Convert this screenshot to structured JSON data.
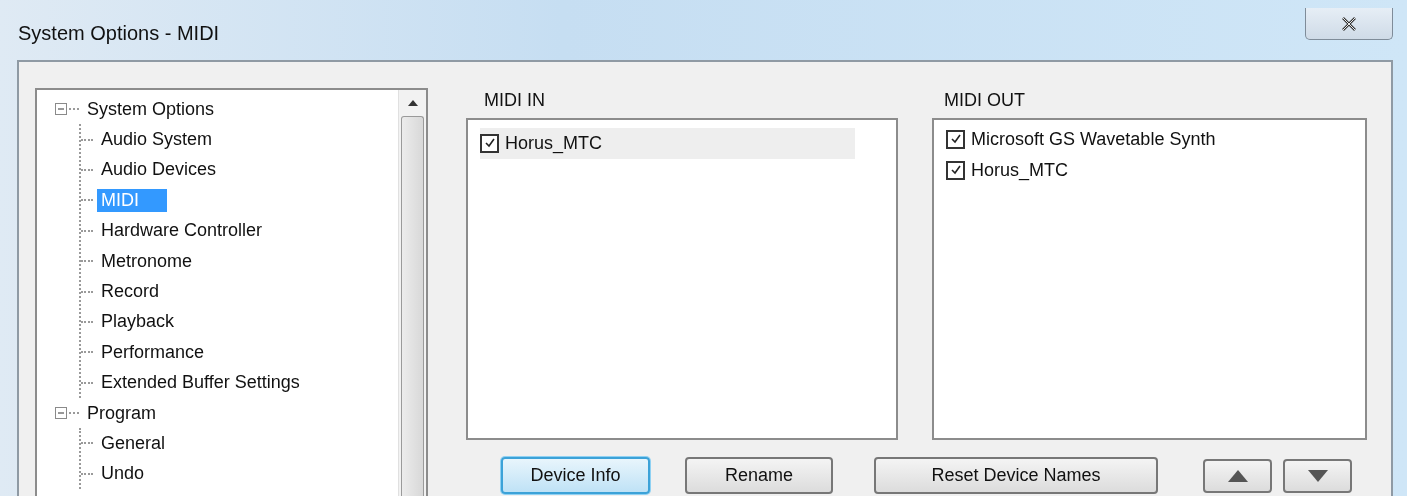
{
  "window": {
    "title": "System Options - MIDI"
  },
  "tree": [
    {
      "label": "System Options",
      "expanded": true,
      "selected": false,
      "children": [
        {
          "label": "Audio System",
          "selected": false
        },
        {
          "label": "Audio Devices",
          "selected": false
        },
        {
          "label": "MIDI",
          "selected": true
        },
        {
          "label": "Hardware Controller",
          "selected": false
        },
        {
          "label": "Metronome",
          "selected": false
        },
        {
          "label": "Record",
          "selected": false
        },
        {
          "label": "Playback",
          "selected": false
        },
        {
          "label": "Performance",
          "selected": false
        },
        {
          "label": "Extended Buffer Settings",
          "selected": false
        }
      ]
    },
    {
      "label": "Program",
      "expanded": true,
      "selected": false,
      "children": [
        {
          "label": "General",
          "selected": false
        },
        {
          "label": "Undo",
          "selected": false
        }
      ]
    }
  ],
  "midi_in": {
    "label": "MIDI IN",
    "devices": [
      {
        "name": "Horus_MTC",
        "checked": true,
        "selected": true
      }
    ]
  },
  "midi_out": {
    "label": "MIDI OUT",
    "devices": [
      {
        "name": "Microsoft GS Wavetable Synth",
        "checked": true,
        "selected": false
      },
      {
        "name": "Horus_MTC",
        "checked": true,
        "selected": false
      }
    ]
  },
  "buttons": [
    {
      "label": "Device Info",
      "focused": true
    },
    {
      "label": "Rename",
      "focused": false
    },
    {
      "label": "Reset Device Names",
      "focused": false
    }
  ]
}
